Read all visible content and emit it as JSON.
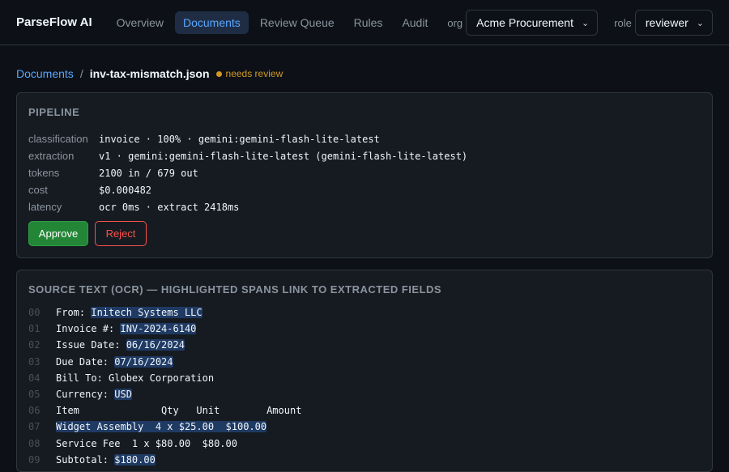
{
  "brand": "ParseFlow AI",
  "nav": [
    "Overview",
    "Documents",
    "Review Queue",
    "Rules",
    "Audit"
  ],
  "org": {
    "label": "org",
    "value": "Acme Procurement"
  },
  "role": {
    "label": "role",
    "value": "reviewer"
  },
  "breadcrumb": {
    "root": "Documents",
    "sep": "/",
    "current": "inv-tax-mismatch.json",
    "status": "needs review"
  },
  "pipeline": {
    "title": "PIPELINE",
    "rows": [
      {
        "key": "classification",
        "value": "invoice · 100% · gemini:gemini-flash-lite-latest"
      },
      {
        "key": "extraction",
        "value": "v1 · gemini:gemini-flash-lite-latest (gemini-flash-lite-latest)"
      },
      {
        "key": "tokens",
        "value": "2100 in / 679 out"
      },
      {
        "key": "cost",
        "value": "$0.000482"
      },
      {
        "key": "latency",
        "value": "ocr 0ms · extract 2418ms"
      }
    ],
    "approve": "Approve",
    "reject": "Reject"
  },
  "source": {
    "title": "SOURCE TEXT (OCR) — HIGHLIGHTED SPANS LINK TO EXTRACTED FIELDS",
    "lines": [
      {
        "n": "00",
        "pre": "From: ",
        "hl": "Initech Systems LLC",
        "post": ""
      },
      {
        "n": "01",
        "pre": "Invoice #: ",
        "hl": "INV-2024-6140",
        "post": ""
      },
      {
        "n": "02",
        "pre": "Issue Date: ",
        "hl": "06/16/2024",
        "post": ""
      },
      {
        "n": "03",
        "pre": "Due Date: ",
        "hl": "07/16/2024",
        "post": ""
      },
      {
        "n": "04",
        "pre": "Bill To: Globex Corporation",
        "hl": "",
        "post": ""
      },
      {
        "n": "05",
        "pre": "Currency: ",
        "hl": "USD",
        "post": ""
      },
      {
        "n": "06",
        "pre": "Item              Qty   Unit        Amount",
        "hl": "",
        "post": ""
      },
      {
        "n": "07",
        "pre": "",
        "hl": "Widget Assembly  4 x $25.00  $100.00",
        "post": ""
      },
      {
        "n": "08",
        "pre": "Service Fee  1 x $80.00  $80.00",
        "hl": "",
        "post": ""
      },
      {
        "n": "09",
        "pre": "Subtotal: ",
        "hl": "$180.00",
        "post": ""
      }
    ]
  }
}
